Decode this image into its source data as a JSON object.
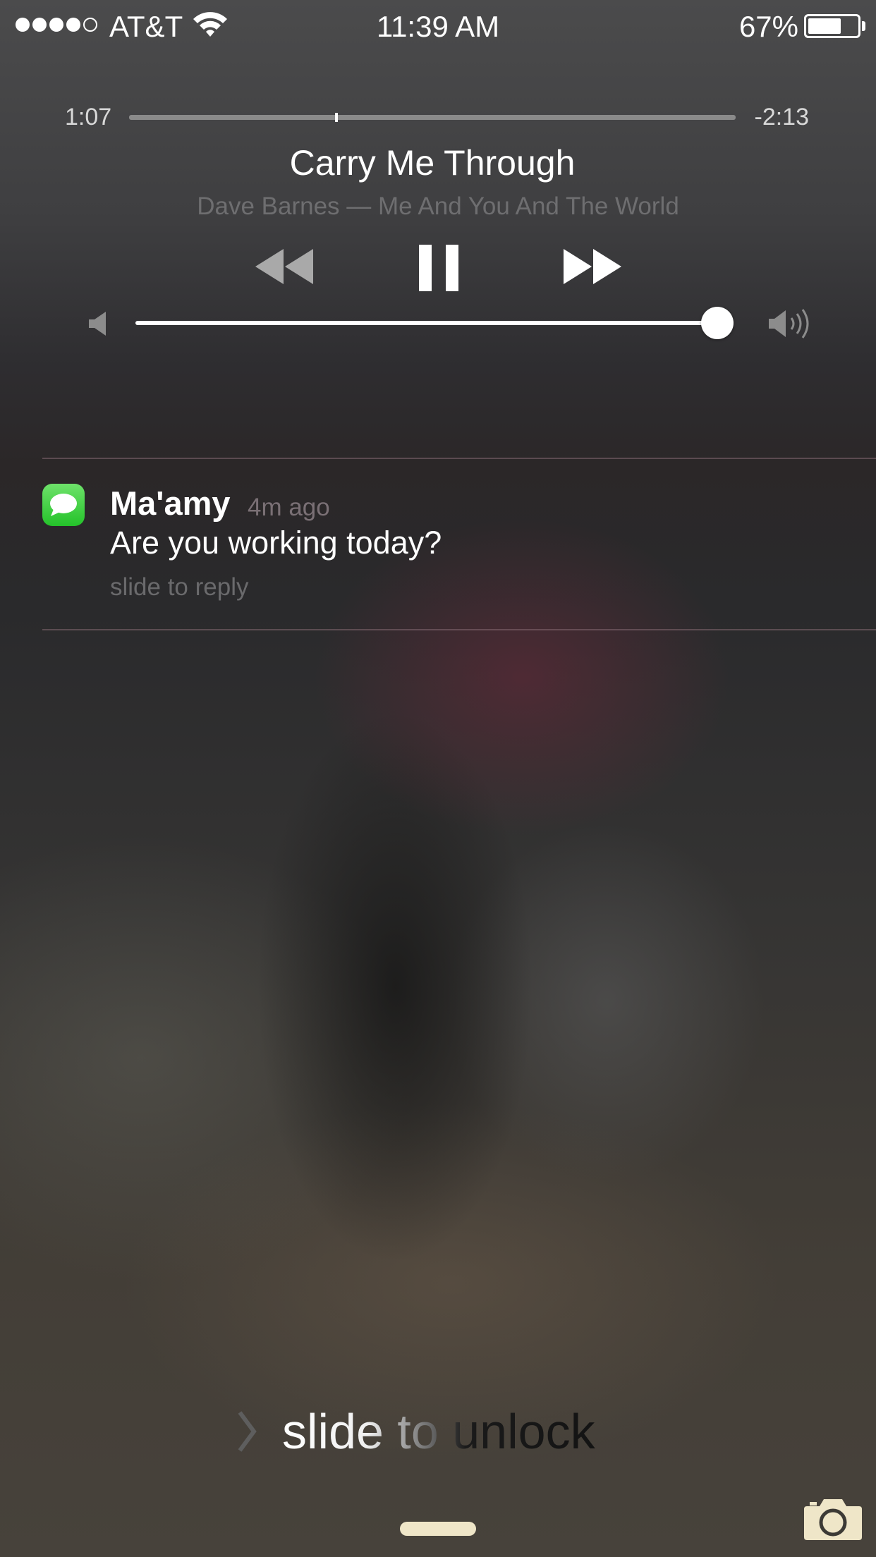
{
  "status_bar": {
    "signal_bars_filled": 4,
    "signal_bars_total": 5,
    "carrier": "AT&T",
    "wifi_icon": "wifi-icon",
    "time": "11:39 AM",
    "battery_percent": "67%",
    "battery_level": 0.67
  },
  "now_playing": {
    "elapsed": "1:07",
    "remaining": "-2:13",
    "progress": 0.34,
    "title": "Carry Me Through",
    "artist_album": "Dave Barnes — Me And You And The World",
    "controls": {
      "previous_icon": "rewind-icon",
      "play_pause_icon": "pause-icon",
      "next_icon": "fast-forward-icon"
    },
    "volume": 0.98,
    "volume_low_icon": "speaker-low-icon",
    "volume_high_icon": "speaker-high-icon"
  },
  "notification": {
    "app_icon": "messages-icon",
    "sender": "Ma'amy",
    "age": "4m ago",
    "message": "Are you working today?",
    "hint": "slide to reply"
  },
  "lock_screen": {
    "unlock_label": "slide to unlock",
    "chevron_icon": "chevron-right-icon",
    "camera_icon": "camera-icon"
  },
  "colors": {
    "messages_green": "#2ac130",
    "grabber": "#efe6c8",
    "secondary_text": "#6e6e70"
  }
}
